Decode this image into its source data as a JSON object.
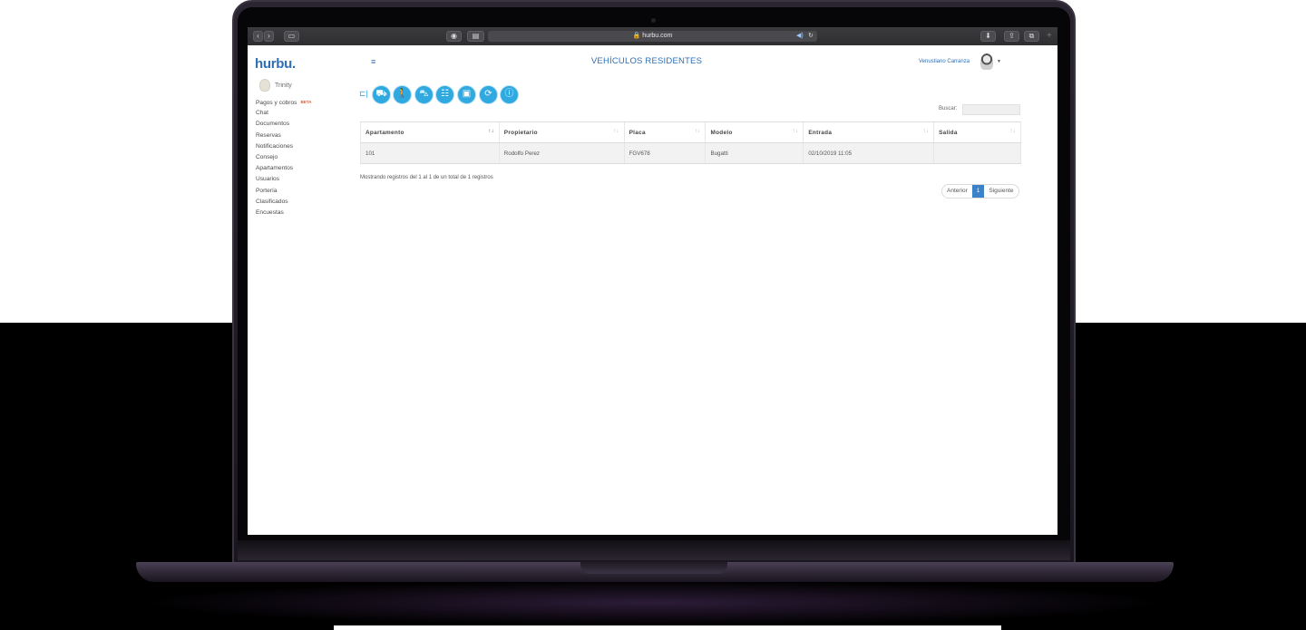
{
  "browser": {
    "url": "hurbu.com"
  },
  "sidebar": {
    "logo": "hurbu.",
    "building": "Trinity",
    "pagos_label": "Pagos y cobros",
    "pagos_badge": "BETA",
    "items": [
      "Chat",
      "Documentos",
      "Reservas",
      "Notificaciones",
      "Consejo",
      "Apartamentos",
      "Usuarios",
      "Portería",
      "Clasificados",
      "Encuestas"
    ]
  },
  "header": {
    "title": "VEHÍCULOS RESIDENTES",
    "user": "Venustiano Carranza"
  },
  "toolbar": {
    "icons": [
      "car-icon",
      "pedestrian-icon",
      "car-pass-icon",
      "group-icon",
      "parking-card-icon",
      "vehicle-history-icon",
      "info-icon"
    ]
  },
  "search": {
    "label": "Buscar:",
    "value": ""
  },
  "table": {
    "headers": [
      "Apartamento",
      "Propietario",
      "Placa",
      "Modelo",
      "Entrada",
      "Salida"
    ],
    "rows": [
      [
        "101",
        "Rodolfo Perez",
        "FGV678",
        "Bugatti",
        "02/10/2019 11:05",
        ""
      ]
    ]
  },
  "footer": {
    "info": "Mostrando registros del 1 al 1 de un total de 1 registros",
    "prev": "Anterior",
    "page": "1",
    "next": "Siguiente"
  },
  "colors": {
    "accent": "#2d6eb5",
    "icon_fill": "#2fa9e0",
    "pager_active": "#3b82c8"
  }
}
